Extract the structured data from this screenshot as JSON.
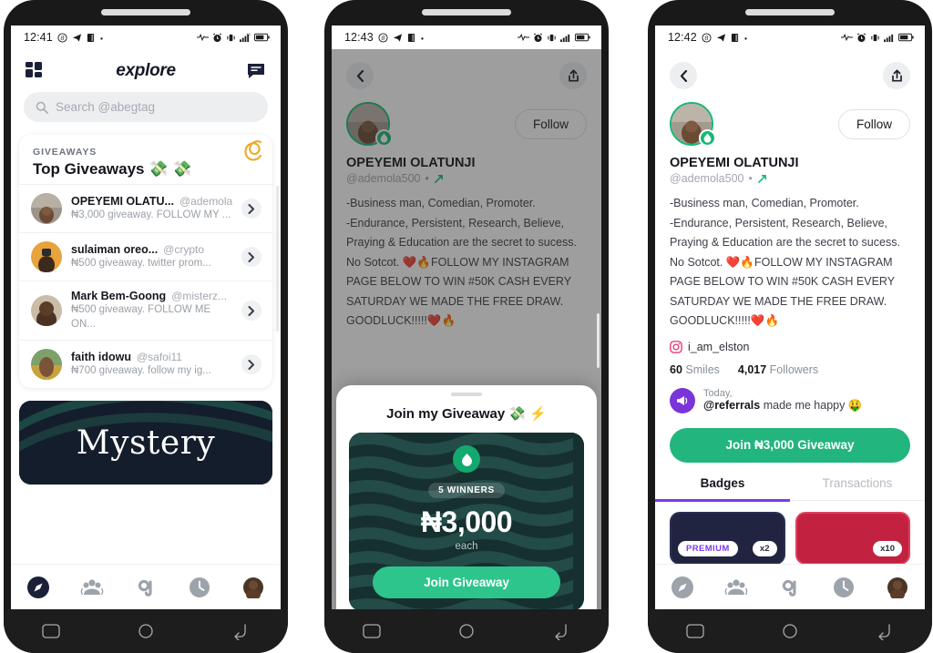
{
  "app": {
    "accent_green": "#23b57e",
    "accent_purple": "#7c3aed",
    "dark": "#141d2b"
  },
  "phone1": {
    "status": {
      "time": "12:41",
      "icons": [
        "dnd-icon",
        "telegram-icon",
        "sim-icon",
        "dot-icon",
        "pulse-icon",
        "alarm-icon",
        "vibrate-icon",
        "signal-icon",
        "battery-icon"
      ]
    },
    "header": {
      "menu_icon": "grid-icon",
      "title": "explore",
      "chat_icon": "chat-icon"
    },
    "search": {
      "placeholder": "Search @abegtag",
      "icon": "search-icon"
    },
    "giveaways_card": {
      "kicker": "GIVEAWAYS",
      "title": "Top Giveaways 💸 💸",
      "decoration": "spiral-icon",
      "items": [
        {
          "name": "OPEYEMI OLATU...",
          "handle": "@ademola...",
          "desc": "₦3,000 giveaway. FOLLOW MY ..."
        },
        {
          "name": "sulaiman oreo...",
          "handle": "@crypto",
          "desc": "₦500 giveaway. twitter prom..."
        },
        {
          "name": "Mark Bem-Goong",
          "handle": "@misterz...",
          "desc": "₦500 giveaway. FOLLOW ME ON..."
        },
        {
          "name": "faith idowu",
          "handle": "@safoi11",
          "desc": "₦700 giveaway. follow my ig..."
        }
      ]
    },
    "banner": {
      "text": "Mystery"
    },
    "tabbar": [
      "compass-icon",
      "people-icon",
      "abeg-logo-icon",
      "clock-icon",
      "avatar-icon"
    ]
  },
  "phone2": {
    "status": {
      "time": "12:43"
    },
    "nav": {
      "back_icon": "back-icon",
      "share_icon": "share-icon"
    },
    "profile": {
      "name": "OPEYEMI OLATUNJI",
      "handle": "@ademola500",
      "handle_suffix": "•",
      "verified_icon": "arrow-badge-icon",
      "follow_label": "Follow",
      "bio": "-Business man, Comedian, Promoter.\n-Endurance, Persistent, Research, Believe,\nPraying & Education are the secret to sucess.\nNo Sotcot. ❤️🔥FOLLOW MY INSTAGRAM\nPAGE BELOW TO WIN #50K CASH EVERY\nSATURDAY WE MADE THE FREE DRAW.\nGOODLUCK!!!!!❤️🔥"
    },
    "modal": {
      "title": "Join my Giveaway 💸 ⚡",
      "badge_icon": "drop-icon",
      "winners": "5 WINNERS",
      "amount": "₦3,000",
      "each": "each",
      "cta": "Join Giveaway"
    }
  },
  "phone3": {
    "status": {
      "time": "12:42"
    },
    "nav": {
      "back_icon": "back-icon",
      "share_icon": "share-icon"
    },
    "profile": {
      "name": "OPEYEMI OLATUNJI",
      "handle": "@ademola500",
      "handle_suffix": "•",
      "follow_label": "Follow",
      "bio": "-Business man, Comedian, Promoter.\n-Endurance, Persistent, Research, Believe,\nPraying & Education are the secret to sucess.\nNo Sotcot. ❤️🔥FOLLOW MY INSTAGRAM\nPAGE BELOW TO WIN #50K CASH EVERY\nSATURDAY WE MADE THE FREE DRAW.\nGOODLUCK!!!!!❤️🔥",
      "instagram": "i_am_elston",
      "stats": [
        {
          "value": "60",
          "label": "Smiles"
        },
        {
          "value": "4,017",
          "label": "Followers"
        }
      ],
      "referral": {
        "when": "Today,",
        "who": "@referrals",
        "text": "made me happy 🤑"
      },
      "cta": "Join ₦3,000 Giveaway"
    },
    "tabs": [
      {
        "label": "Badges",
        "active": true
      },
      {
        "label": "Transactions",
        "active": false
      }
    ],
    "badges": [
      {
        "label": "PREMIUM",
        "count": "x2",
        "color": "#202440"
      },
      {
        "label": "",
        "count": "x10",
        "color": "#c2223f"
      }
    ]
  },
  "system_nav": [
    "recents-icon",
    "home-icon",
    "back-icon"
  ]
}
